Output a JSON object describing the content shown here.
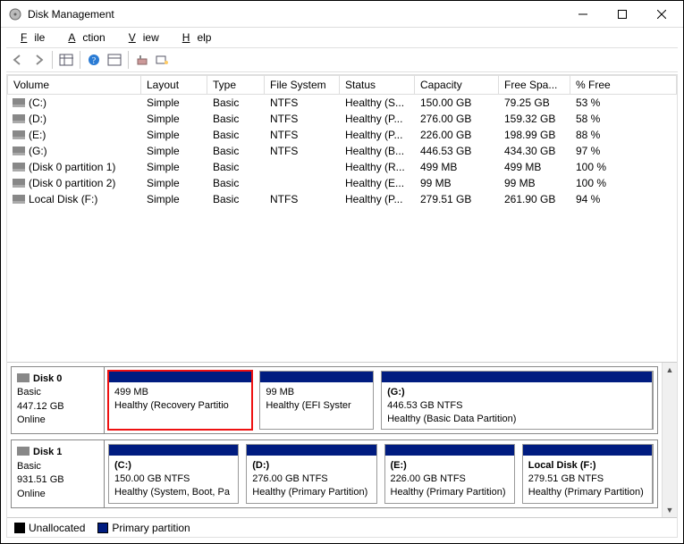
{
  "window": {
    "title": "Disk Management"
  },
  "menu": {
    "file": "File",
    "action": "Action",
    "view": "View",
    "help": "Help"
  },
  "columns": {
    "volume": "Volume",
    "layout": "Layout",
    "type": "Type",
    "fs": "File System",
    "status": "Status",
    "capacity": "Capacity",
    "free": "Free Spa...",
    "pct": "% Free"
  },
  "volumes": [
    {
      "name": "(C:)",
      "layout": "Simple",
      "type": "Basic",
      "fs": "NTFS",
      "status": "Healthy (S...",
      "capacity": "150.00 GB",
      "free": "79.25 GB",
      "pct": "53 %"
    },
    {
      "name": "(D:)",
      "layout": "Simple",
      "type": "Basic",
      "fs": "NTFS",
      "status": "Healthy (P...",
      "capacity": "276.00 GB",
      "free": "159.32 GB",
      "pct": "58 %"
    },
    {
      "name": "(E:)",
      "layout": "Simple",
      "type": "Basic",
      "fs": "NTFS",
      "status": "Healthy (P...",
      "capacity": "226.00 GB",
      "free": "198.99 GB",
      "pct": "88 %"
    },
    {
      "name": "(G:)",
      "layout": "Simple",
      "type": "Basic",
      "fs": "NTFS",
      "status": "Healthy (B...",
      "capacity": "446.53 GB",
      "free": "434.30 GB",
      "pct": "97 %"
    },
    {
      "name": "(Disk 0 partition 1)",
      "layout": "Simple",
      "type": "Basic",
      "fs": "",
      "status": "Healthy (R...",
      "capacity": "499 MB",
      "free": "499 MB",
      "pct": "100 %"
    },
    {
      "name": "(Disk 0 partition 2)",
      "layout": "Simple",
      "type": "Basic",
      "fs": "",
      "status": "Healthy (E...",
      "capacity": "99 MB",
      "free": "99 MB",
      "pct": "100 %"
    },
    {
      "name": "Local Disk (F:)",
      "layout": "Simple",
      "type": "Basic",
      "fs": "NTFS",
      "status": "Healthy (P...",
      "capacity": "279.51 GB",
      "free": "261.90 GB",
      "pct": "94 %"
    }
  ],
  "disks": [
    {
      "name": "Disk 0",
      "type": "Basic",
      "size": "447.12 GB",
      "state": "Online",
      "partitions": [
        {
          "label": "",
          "size": "499 MB",
          "status": "Healthy (Recovery Partitio",
          "highlight": true,
          "flex": 1.9
        },
        {
          "label": "",
          "size": "99 MB",
          "status": "Healthy (EFI Syster",
          "flex": 1.5
        },
        {
          "label": "(G:)",
          "size": "446.53 GB NTFS",
          "status": "Healthy (Basic Data Partition)",
          "flex": 3.6
        }
      ]
    },
    {
      "name": "Disk 1",
      "type": "Basic",
      "size": "931.51 GB",
      "state": "Online",
      "partitions": [
        {
          "label": "(C:)",
          "size": "150.00 GB NTFS",
          "status": "Healthy (System, Boot, Pa",
          "flex": 1
        },
        {
          "label": "(D:)",
          "size": "276.00 GB NTFS",
          "status": "Healthy (Primary Partition)",
          "flex": 1
        },
        {
          "label": "(E:)",
          "size": "226.00 GB NTFS",
          "status": "Healthy (Primary Partition)",
          "flex": 1
        },
        {
          "label": "Local Disk  (F:)",
          "size": "279.51 GB NTFS",
          "status": "Healthy (Primary Partition)",
          "flex": 1
        }
      ]
    }
  ],
  "legend": {
    "unallocated": "Unallocated",
    "primary": "Primary partition"
  },
  "colors": {
    "pbar": "#001c80",
    "unalloc": "#000000",
    "highlight": "#e11"
  }
}
